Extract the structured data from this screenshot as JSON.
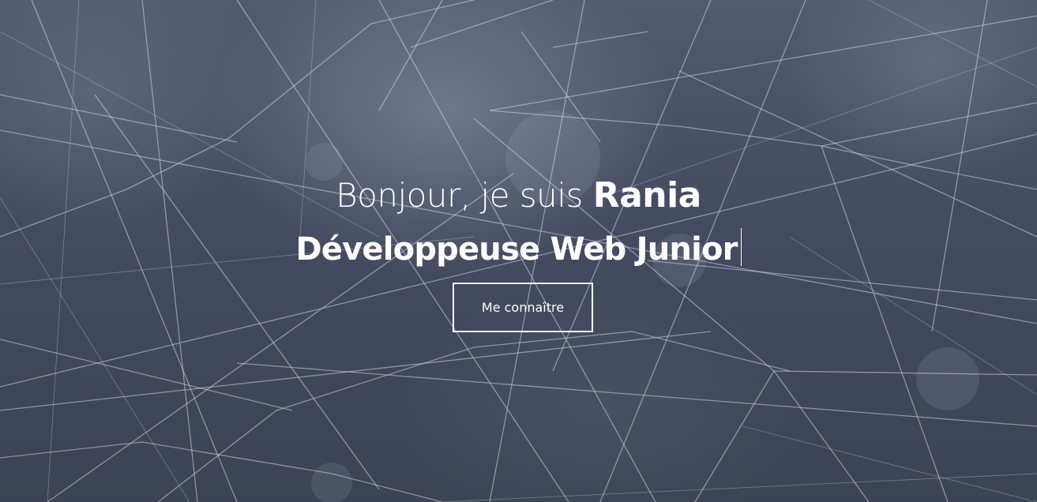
{
  "hero": {
    "greeting_prefix": "Bonjour, je suis",
    "name": "Rania",
    "role": "Développeuse Web Junior",
    "cta_label": "Me connaître",
    "background_image": "spider-web-network-icon",
    "colors": {
      "overlay": "#3e4558",
      "text": "#ffffff",
      "button_border": "#ffffff"
    }
  }
}
